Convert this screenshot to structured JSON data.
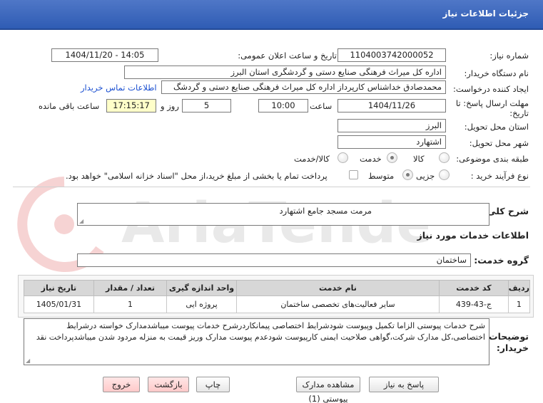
{
  "window": {
    "title": "جزئیات اطلاعات نیاز"
  },
  "fields": {
    "need_number_label": "شماره نیاز:",
    "need_number": "1104003742000052",
    "announce_label": "تاریخ و ساعت اعلان عمومی:",
    "announce_value": "1404/11/20 - 14:05",
    "buyer_org_label": "نام دستگاه خریدار:",
    "buyer_org": "اداره کل میراث فرهنگی  صنایع دستی و گردشگری استان البرز",
    "creator_label": "ایجاد کننده درخواست:",
    "creator": "محمدصادق خداشناس  کارپرداز اداره کل میراث فرهنگی  صنایع دستی و گردشگ",
    "contact_link": "اطلاعات تماس خریدار",
    "deadline_label_1": "مهلت ارسال پاسخ: تا",
    "deadline_label_2": "تاریخ:",
    "deadline_date": "1404/11/26",
    "time_label": "ساعت",
    "deadline_time": "10:00",
    "days_value": "5",
    "days_label": "روز و",
    "remaining_time": "17:15:17",
    "remaining_label": "ساعت باقی مانده",
    "province_label": "استان محل تحویل:",
    "province": "البرز",
    "city_label": "شهر محل تحویل:",
    "city": "اشتهارد",
    "category_label": "طبقه بندی موضوعی:",
    "category_options": [
      "کالا",
      "خدمت",
      "کالا/خدمت"
    ],
    "category_selected": "خدمت",
    "purchase_type_label": "نوع فرآیند خرید :",
    "purchase_options": [
      "جزیی",
      "متوسط"
    ],
    "purchase_selected": "متوسط",
    "treasury_note": "پرداخت تمام یا بخشی از مبلغ خرید،از محل \"اسناد خزانه اسلامی\" خواهد بود."
  },
  "general_description": {
    "label": "شرح کلی نیاز:",
    "value": "مرمت مسجد جامع اشتهارد"
  },
  "services_section": {
    "title": "اطلاعات خدمات مورد نیاز"
  },
  "service_group": {
    "label": "گروه خدمت:",
    "value": "ساختمان"
  },
  "table": {
    "headers": [
      "ردیف",
      "کد خدمت",
      "نام خدمت",
      "واحد اندازه گیری",
      "تعداد / مقدار",
      "تاریخ نیاز"
    ],
    "rows": [
      [
        "1",
        "ج-43-439",
        "سایر فعالیت‌های تخصصی ساختمان",
        "پروژه ایی",
        "1",
        "1405/01/31"
      ]
    ]
  },
  "buyer_notes": {
    "label_1": "توضیحات",
    "label_2": "خریدار:",
    "value": "شرح خدمات پیوستی الزاما تکمیل وپیوست شودشرایط اختصاصی پیمانکاردرشرح خدمات پیوست میباشدمدارک خواسته درشرایط اختصاصی،کل مدارک شرکت،گواهی صلاحیت ایمنی کارپیوست شودعدم پیوست مدارک وریز قیمت به منزله مردود شدن میباشدپرداخت نقد"
  },
  "buttons": {
    "reply": "پاسخ به نیاز",
    "attachments": "مشاهده مدارک پیوستی (1)",
    "print": "چاپ",
    "back": "بازگشت",
    "exit": "خروج"
  },
  "watermark": {
    "text": "AriaTender.neT"
  },
  "colors": {
    "title_bar": "#2f5cb4",
    "highlight": "#ffffc9",
    "link": "#1a4fd1",
    "watermark": "#d93a3a"
  }
}
